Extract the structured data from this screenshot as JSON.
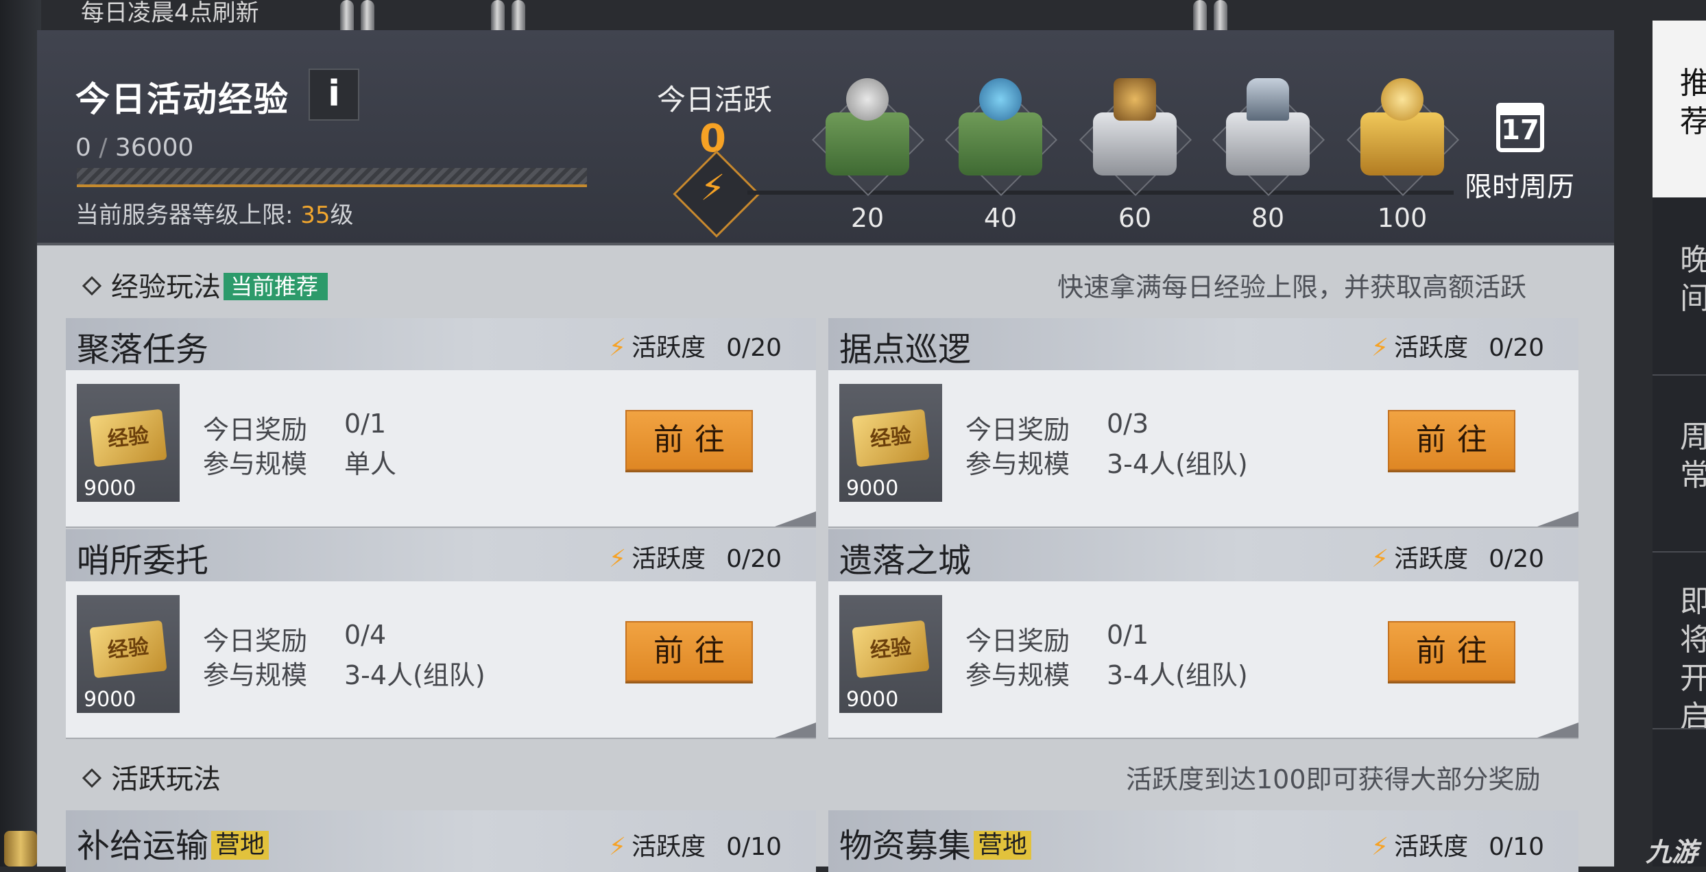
{
  "top_notice": "每日凌晨4点刷新",
  "header": {
    "title": "今日活动经验",
    "info_label": "i",
    "exp_current": "0",
    "exp_separator": " / ",
    "exp_max": "36000",
    "server_cap_prefix": "当前服务器等级上限: ",
    "server_cap_level": "35",
    "server_cap_suffix": "级"
  },
  "activity": {
    "label": "今日活跃",
    "value": "0",
    "progress_fraction": 0,
    "milestones": [
      {
        "points": "20",
        "icon": "silver-eagle-green-chest-icon"
      },
      {
        "points": "40",
        "icon": "lightning-badge-green-chest-icon"
      },
      {
        "points": "60",
        "icon": "shield-badge-gray-chest-icon"
      },
      {
        "points": "80",
        "icon": "armor-gray-chest-icon"
      },
      {
        "points": "100",
        "icon": "gold-coin-gold-chest-icon"
      }
    ]
  },
  "calendar": {
    "day": "17",
    "label": "限时周历"
  },
  "exp_section": {
    "title": "经验玩法",
    "tag": "当前推荐",
    "hint": "快速拿满每日经验上限，并获取高额活跃"
  },
  "active_section": {
    "title": "活跃玩法",
    "hint": "活跃度到达100即可获得大部分奖励"
  },
  "common": {
    "activity_label": "活跃度",
    "reward_label": "今日奖励",
    "scale_label": "参与规模",
    "go_label": "前往",
    "ticket_text": "经验"
  },
  "cards": [
    {
      "name": "聚落任务",
      "progress": "0/20",
      "reward": "0/1",
      "scale": "单人",
      "exp_value": "9000"
    },
    {
      "name": "据点巡逻",
      "progress": "0/20",
      "reward": "0/3",
      "scale": "3-4人(组队)",
      "exp_value": "9000"
    },
    {
      "name": "哨所委托",
      "progress": "0/20",
      "reward": "0/4",
      "scale": "3-4人(组队)",
      "exp_value": "9000"
    },
    {
      "name": "遗落之城",
      "progress": "0/20",
      "reward": "0/1",
      "scale": "3-4人(组队)",
      "exp_value": "9000"
    }
  ],
  "mini_cards": [
    {
      "name": "补给运输",
      "tag": "营地",
      "progress": "0/10"
    },
    {
      "name": "物资募集",
      "tag": "营地",
      "progress": "0/10"
    }
  ],
  "right_sidebar": [
    "推荐",
    "晚间",
    "周常",
    "即将开启"
  ],
  "watermark": "九游",
  "colors": {
    "accent": "#f6a225",
    "recommend_tag": "#2c9a6a",
    "camp_tag": "#e2c23c",
    "go_button": "#e9962f"
  }
}
